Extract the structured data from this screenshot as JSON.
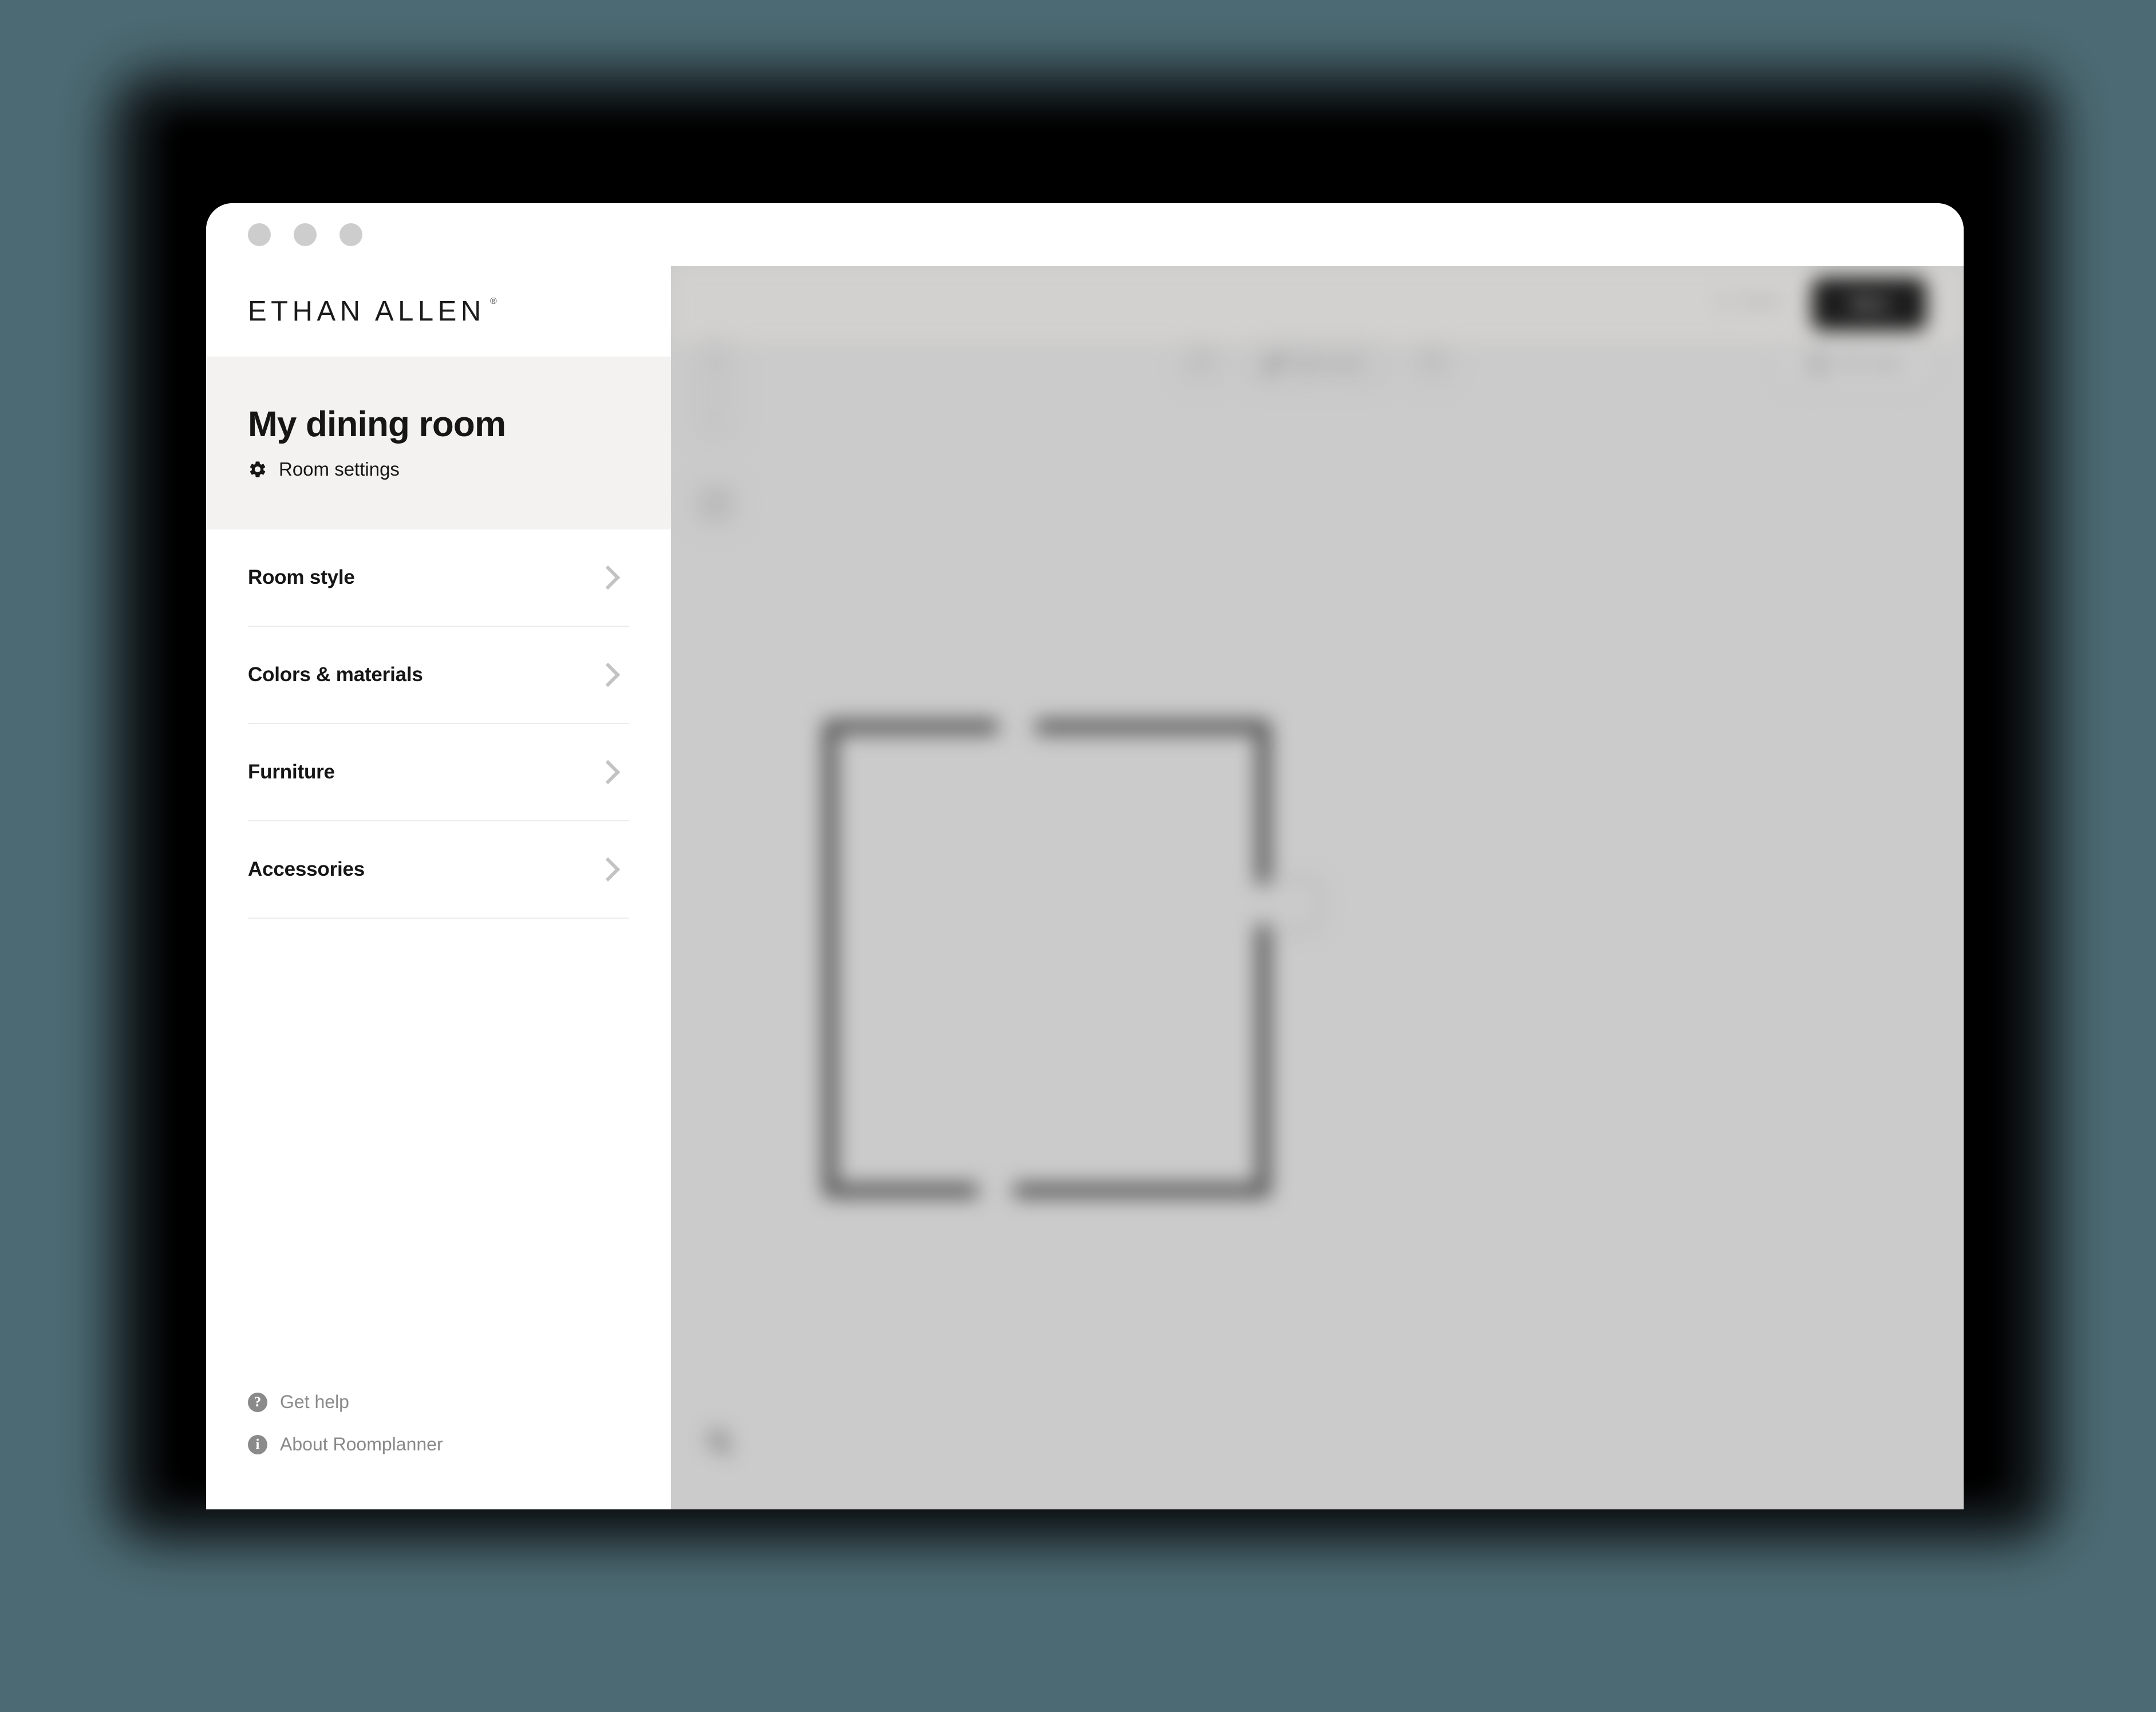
{
  "window": {
    "traffic_lights": [
      "close",
      "minimize",
      "maximize"
    ]
  },
  "sidebar": {
    "brand": {
      "name": "ETHAN ALLEN",
      "trademark": "®"
    },
    "room": {
      "title": "My dining room",
      "settings_label": "Room settings",
      "settings_icon": "gear-icon"
    },
    "nav_items": [
      {
        "label": "Room style",
        "chevron": "chevron-right-icon"
      },
      {
        "label": "Colors & materials",
        "chevron": "chevron-right-icon"
      },
      {
        "label": "Furniture",
        "chevron": "chevron-right-icon"
      },
      {
        "label": "Accessories",
        "chevron": "chevron-right-icon"
      }
    ],
    "footer_links": [
      {
        "label": "Get help",
        "icon": "help-circle-icon",
        "glyph": "?"
      },
      {
        "label": "About Roomplanner",
        "icon": "info-circle-icon",
        "glyph": "i"
      }
    ]
  },
  "canvas": {
    "header": {
      "save_label": "Save",
      "save_icon": "save-icon",
      "primary_button_label": "Next"
    },
    "left_tools": {
      "zoom_in_label": "+",
      "zoom_in_icon": "plus-icon",
      "zoom_out_label": "−",
      "zoom_out_icon": "minus-icon",
      "fit_icon": "fit-to-screen-icon"
    },
    "center_toolbar": {
      "undo_label": "↶",
      "undo_icon": "undo-icon",
      "edit_label": "Edit room",
      "edit_icon": "pencil-icon",
      "redo_label": "↷",
      "redo_icon": "redo-icon"
    },
    "view_toggle": {
      "label": "3D view",
      "icon": "cube-icon"
    },
    "bottom_tool": {
      "icon": "measure-icon"
    }
  },
  "colors": {
    "page_background": "#4c6a73",
    "window_background": "#ffffff",
    "sidebar_header_band": "#f3f2f0",
    "canvas_background": "#cbcbcb",
    "canvas_header_band": "#d2d1cf",
    "wall_stroke": "#5a5a5a",
    "primary_button": "#1c1c1c",
    "text_primary": "#161616",
    "text_muted": "#8a8a8a",
    "divider": "#ececec"
  },
  "floorplan": {
    "shape": "rectangle",
    "wall_openings": [
      {
        "side": "top",
        "type": "opening"
      },
      {
        "side": "bottom",
        "type": "opening"
      },
      {
        "side": "right",
        "type": "door",
        "swing": "outward"
      }
    ]
  }
}
